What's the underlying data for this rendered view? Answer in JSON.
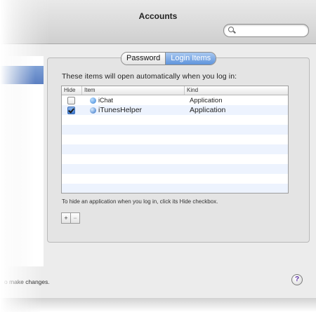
{
  "window": {
    "title": "Accounts"
  },
  "search": {
    "placeholder": ""
  },
  "tabs": [
    {
      "label": "Password",
      "active": false
    },
    {
      "label": "Login Items",
      "active": true
    }
  ],
  "login_items": {
    "intro": "These items will open automatically when you log in:",
    "columns": {
      "hide": "Hide",
      "item": "Item",
      "kind": "Kind"
    },
    "rows": [
      {
        "hide": false,
        "name": "iChat",
        "kind": "Application",
        "icon": "ichat-icon"
      },
      {
        "hide": true,
        "name": "iTunesHelper",
        "kind": "Application",
        "icon": "itunes-helper-icon"
      }
    ],
    "hint": "To hide an application when you log in, click its Hide checkbox.",
    "add_label": "+",
    "remove_label": "−"
  },
  "footer": {
    "lock_text": "o make changes.",
    "help_label": "?"
  },
  "colors": {
    "selection": "#5f94dc",
    "row_alt": "#edf3fe"
  }
}
